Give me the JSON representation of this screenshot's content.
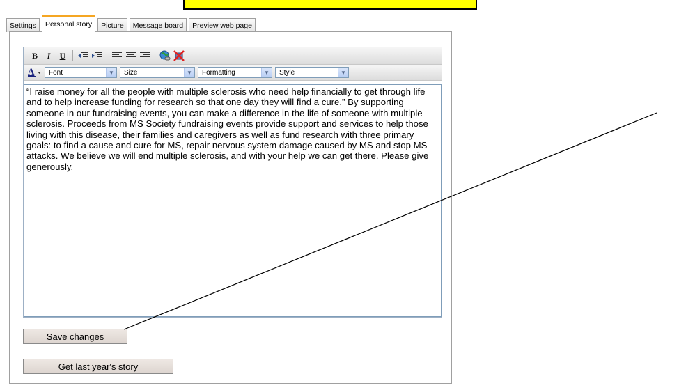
{
  "tabs": [
    {
      "label": "Settings"
    },
    {
      "label": "Personal story"
    },
    {
      "label": "Picture"
    },
    {
      "label": "Message board"
    },
    {
      "label": "Preview web page"
    }
  ],
  "active_tab": "Personal story",
  "toolbar": {
    "bold_label": "B",
    "italic_label": "I",
    "underline_label": "U",
    "font_select": "Font",
    "size_select": "Size",
    "formatting_select": "Formatting",
    "style_select": "Style",
    "icons": [
      "bold-icon",
      "italic-icon",
      "underline-icon",
      "outdent-icon",
      "indent-icon",
      "align-left-icon",
      "align-center-icon",
      "align-right-icon",
      "insert-link-icon",
      "remove-link-icon",
      "font-color-icon"
    ]
  },
  "story": {
    "text": "“I raise money for all the people with multiple sclerosis who need help financially to get through life and to help increase funding for research so that one day they will find a cure.” By supporting someone in our fundraising events, you can make a difference in the life of someone with multiple sclerosis. Proceeds from MS Society fundraising events provide support and services to help those living with this disease, their families and caregivers as well as fund research with three primary goals: to find a cause and cure for MS, repair nervous system damage caused by MS and stop MS attacks. We believe we will end multiple sclerosis, and with your help we can get there. Please give generously."
  },
  "buttons": {
    "save_label": "Save changes",
    "last_year_label": "Get last year's story"
  },
  "colors": {
    "callout": "#ffff00",
    "active_tab_accent": "#f5a623"
  }
}
